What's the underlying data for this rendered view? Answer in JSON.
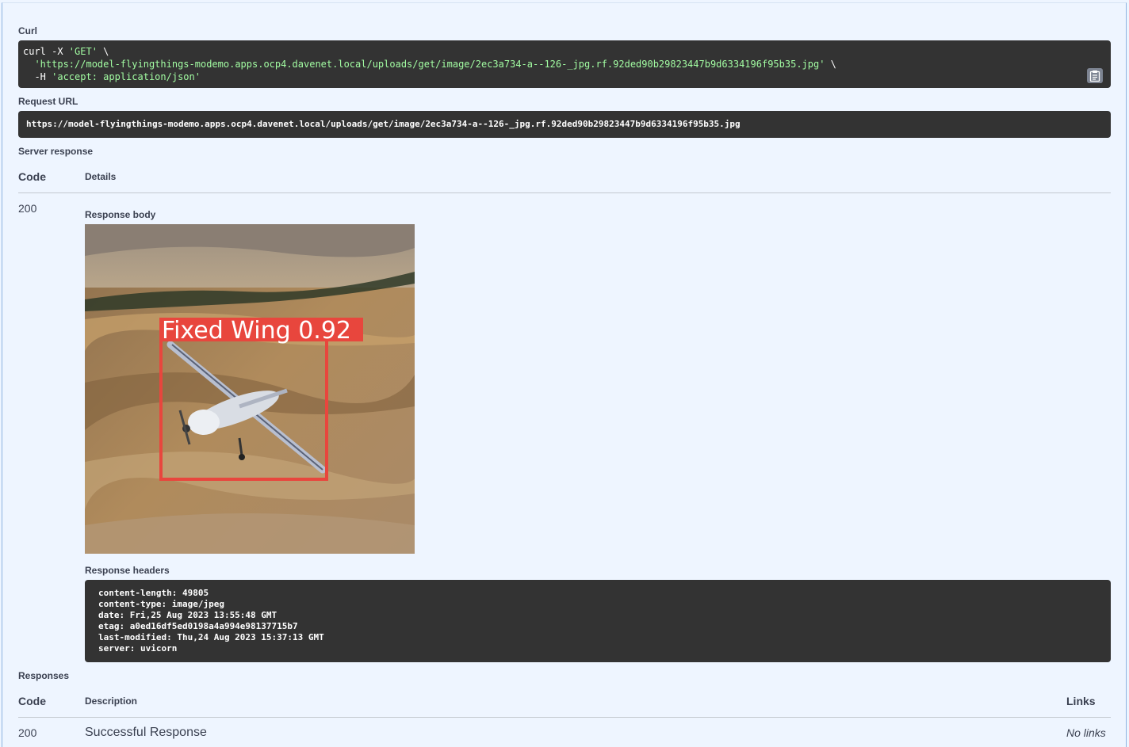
{
  "curl": {
    "label": "Curl",
    "line1_cmd": "curl -X ",
    "line1_str": "'GET'",
    "line1_tail": " \\",
    "line2_str": "'https://model-flyingthings-modemo.apps.ocp4.davenet.local/uploads/get/image/2ec3a734-a--126-_jpg.rf.92ded90b29823447b9d6334196f95b35.jpg'",
    "line2_tail": " \\",
    "line3_cmd": "  -H ",
    "line3_str": "'accept: application/json'",
    "copy_icon": "clipboard-icon"
  },
  "request_url": {
    "label": "Request URL",
    "value": "https://model-flyingthings-modemo.apps.ocp4.davenet.local/uploads/get/image/2ec3a734-a--126-_jpg.rf.92ded90b29823447b9d6334196f95b35.jpg"
  },
  "server_response": {
    "label": "Server response",
    "col_code": "Code",
    "col_details": "Details",
    "code": "200",
    "body_label": "Response body",
    "detection_label": "Fixed Wing 0.92",
    "detection_color": "#e8463d",
    "headers_label": "Response headers",
    "headers": [
      "content-length: 49805",
      "content-type: image/jpeg",
      "date: Fri,25 Aug 2023 13:55:48 GMT",
      "etag: a0ed16df5ed0198a4a994e98137715b7",
      "last-modified: Thu,24 Aug 2023 15:37:13 GMT",
      "server: uvicorn"
    ]
  },
  "responses": {
    "label": "Responses",
    "col_code": "Code",
    "col_description": "Description",
    "col_links": "Links",
    "rows": [
      {
        "code": "200",
        "description": "Successful Response",
        "links": "No links"
      }
    ]
  }
}
